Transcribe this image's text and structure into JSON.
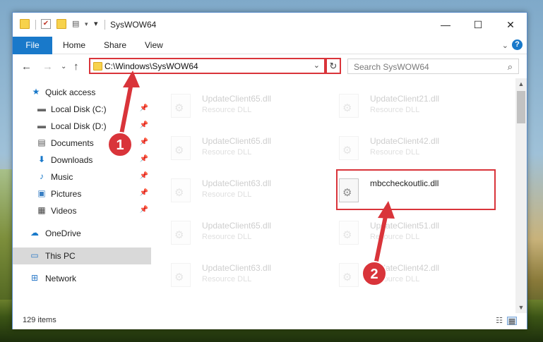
{
  "window": {
    "title": "SysWOW64",
    "controls": {
      "minimize": "—",
      "maximize": "☐",
      "close": "✕"
    }
  },
  "ribbon": {
    "tabs": [
      {
        "label": "File"
      },
      {
        "label": "Home"
      },
      {
        "label": "Share"
      },
      {
        "label": "View"
      }
    ],
    "expand_glyph": "⌄",
    "help_glyph": "?"
  },
  "navigation": {
    "back": "←",
    "forward": "→",
    "recent": "⌄",
    "up": "↑",
    "address": "C:\\Windows\\SysWOW64",
    "refresh": "↻",
    "search_placeholder": "Search SysWOW64"
  },
  "sidebar": {
    "items": [
      {
        "label": "Quick access",
        "icon": "star-icon",
        "pinned": false
      },
      {
        "label": "Local Disk (C:)",
        "icon": "drive-icon",
        "pinned": true
      },
      {
        "label": "Local Disk (D:)",
        "icon": "drive-icon",
        "pinned": true
      },
      {
        "label": "Documents",
        "icon": "document-icon",
        "pinned": true
      },
      {
        "label": "Downloads",
        "icon": "download-icon",
        "pinned": true
      },
      {
        "label": "Music",
        "icon": "music-icon",
        "pinned": true
      },
      {
        "label": "Pictures",
        "icon": "pictures-icon",
        "pinned": true
      },
      {
        "label": "Videos",
        "icon": "video-icon",
        "pinned": true
      },
      {
        "label": "OneDrive",
        "icon": "cloud-icon",
        "pinned": false
      },
      {
        "label": "This PC",
        "icon": "computer-icon",
        "pinned": false,
        "selected": true
      },
      {
        "label": "Network",
        "icon": "network-icon",
        "pinned": false
      }
    ]
  },
  "files": [
    {
      "name": "UpdateClient65.dll",
      "type": "Resource DLL",
      "faded": true
    },
    {
      "name": "UpdateClient21.dll",
      "type": "Resource DLL",
      "faded": true
    },
    {
      "name": "UpdateClient65.dll",
      "type": "Resource DLL",
      "faded": true
    },
    {
      "name": "UpdateClient42.dll",
      "type": "Resource DLL",
      "faded": true
    },
    {
      "name": "UpdateClient63.dll",
      "type": "Resource DLL",
      "faded": true
    },
    {
      "name": "mbccheckoutlic.dll",
      "type": "",
      "faded": false
    },
    {
      "name": "UpdateClient65.dll",
      "type": "Resource DLL",
      "faded": true
    },
    {
      "name": "UpdateClient51.dll",
      "type": "Resource DLL",
      "faded": true
    },
    {
      "name": "UpdateClient63.dll",
      "type": "Resource DLL",
      "faded": true
    },
    {
      "name": "UpdateClient42.dll",
      "type": "Resource DLL",
      "faded": true
    }
  ],
  "status": {
    "item_count": "129 items"
  },
  "annotations": {
    "step1": "1",
    "step2": "2",
    "accent_color": "#d9343a"
  }
}
